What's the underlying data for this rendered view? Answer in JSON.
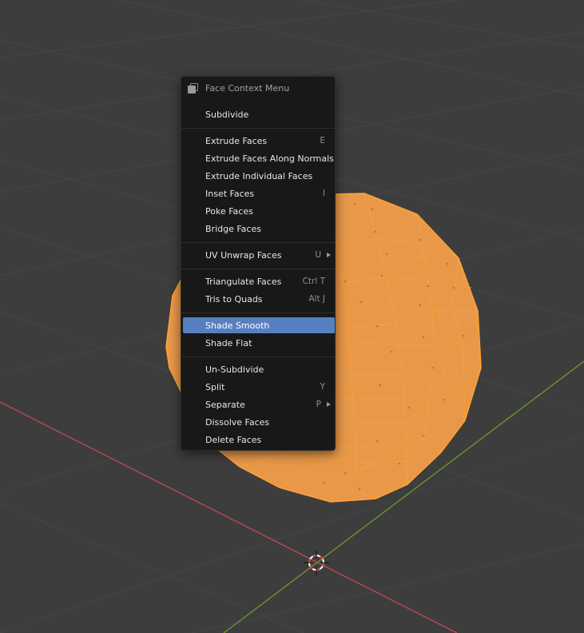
{
  "viewport": {
    "background": "#3d3d3d",
    "grid_color": "#464646",
    "x_axis_color": "#c24a55",
    "y_axis_color": "#6e9a2c",
    "mesh_face_color": "#e89848",
    "mesh_edge_color": "#ffa233"
  },
  "menu": {
    "title": "Face Context Menu",
    "title_icon": "faces-select-icon",
    "highlight_color": "#5680c2",
    "items": [
      {
        "label": "Subdivide",
        "shortcut": "",
        "submenu": false
      },
      {
        "label": "Extrude Faces",
        "shortcut": "E",
        "submenu": false
      },
      {
        "label": "Extrude Faces Along Normals",
        "shortcut": "",
        "submenu": false
      },
      {
        "label": "Extrude Individual Faces",
        "shortcut": "",
        "submenu": false
      },
      {
        "label": "Inset Faces",
        "shortcut": "I",
        "submenu": false
      },
      {
        "label": "Poke Faces",
        "shortcut": "",
        "submenu": false
      },
      {
        "label": "Bridge Faces",
        "shortcut": "",
        "submenu": false
      },
      {
        "label": "UV Unwrap Faces",
        "shortcut": "U",
        "submenu": true
      },
      {
        "label": "Triangulate Faces",
        "shortcut": "Ctrl T",
        "submenu": false
      },
      {
        "label": "Tris to Quads",
        "shortcut": "Alt J",
        "submenu": false
      },
      {
        "label": "Shade Smooth",
        "shortcut": "",
        "submenu": false,
        "active": true
      },
      {
        "label": "Shade Flat",
        "shortcut": "",
        "submenu": false
      },
      {
        "label": "Un-Subdivide",
        "shortcut": "",
        "submenu": false
      },
      {
        "label": "Split",
        "shortcut": "Y",
        "submenu": false
      },
      {
        "label": "Separate",
        "shortcut": "P",
        "submenu": true
      },
      {
        "label": "Dissolve Faces",
        "shortcut": "",
        "submenu": false
      },
      {
        "label": "Delete Faces",
        "shortcut": "",
        "submenu": false
      }
    ]
  }
}
